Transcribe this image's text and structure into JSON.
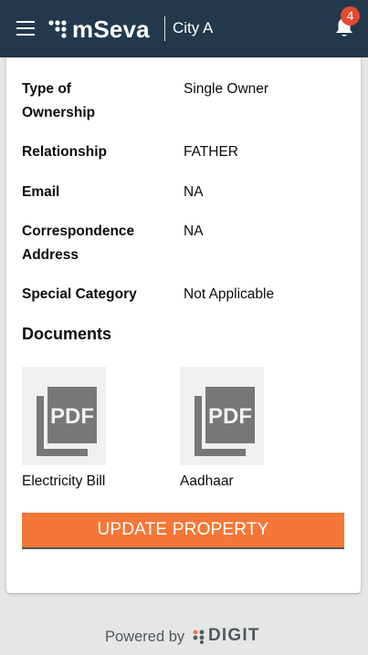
{
  "header": {
    "logo_text": "mSeva",
    "city": "City A",
    "notification_count": "4"
  },
  "details": [
    {
      "label_line1": "Type of",
      "label_line2": "Ownership",
      "value": "Single Owner"
    },
    {
      "label": "Relationship",
      "value": "FATHER"
    },
    {
      "label": "Email",
      "value": "NA"
    },
    {
      "label_line1": "Correspondence",
      "label_line2": "Address",
      "value": "NA"
    },
    {
      "label": "Special Category",
      "value": "Not Applicable"
    }
  ],
  "documents": {
    "title": "Documents",
    "items": [
      {
        "name": "Electricity Bill",
        "thumb_icon": "pdf-icon"
      },
      {
        "name": "Aadhaar",
        "thumb_icon": "pdf-icon"
      }
    ]
  },
  "actions": {
    "update_label": "UPDATE PROPERTY"
  },
  "footer": {
    "powered_by": "Powered by",
    "brand": "DIGIT"
  },
  "colors": {
    "header_bg": "#22394d",
    "accent": "#f47738",
    "badge": "#e34a2f"
  }
}
